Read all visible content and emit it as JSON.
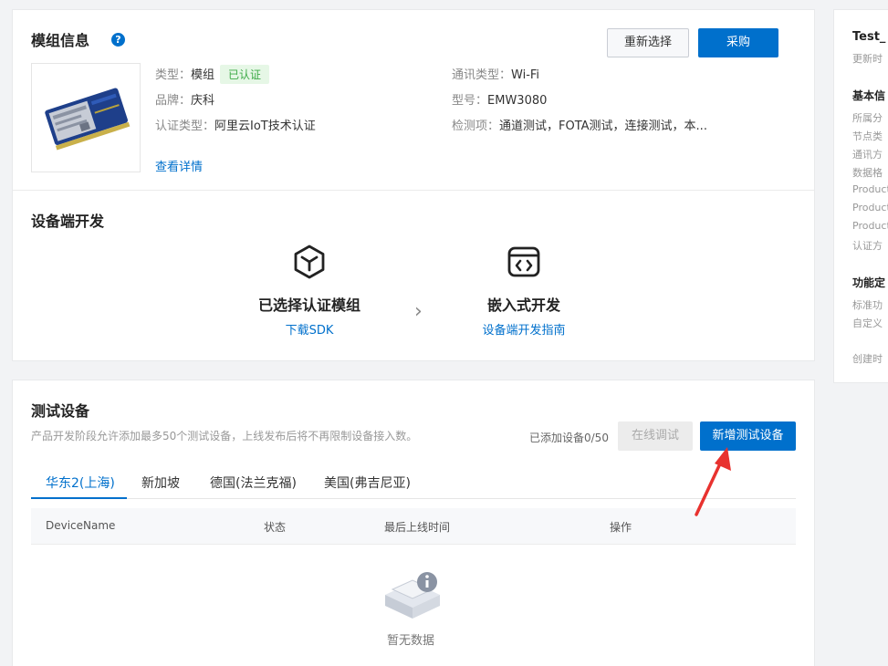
{
  "module": {
    "title": "模组信息",
    "help": "?",
    "reselect_label": "重新选择",
    "purchase_label": "采购",
    "type_key": "类型：",
    "type_val": "模组",
    "certified_tag": "已认证",
    "brand_key": "品牌：",
    "brand_val": "庆科",
    "cert_key": "认证类型：",
    "cert_val": "阿里云IoT技术认证",
    "comm_key": "通讯类型：",
    "comm_val": "Wi-Fi",
    "model_key": "型号：",
    "model_val": "EMW3080",
    "test_key": "检测项：",
    "test_val": "通道测试，FOTA测试，连接测试，本...",
    "detail_link": "查看详情"
  },
  "device_dev": {
    "title": "设备端开发",
    "step1_title": "已选择认证模组",
    "step1_link": "下载SDK",
    "step2_title": "嵌入式开发",
    "step2_link": "设备端开发指南"
  },
  "test_devices": {
    "title": "测试设备",
    "desc": "产品开发阶段允许添加最多50个测试设备，上线发布后将不再限制设备接入数。",
    "count": "已添加设备0/50",
    "online_debug": "在线调试",
    "add_device": "新增测试设备",
    "tabs": [
      "华东2(上海)",
      "新加坡",
      "德国(法兰克福)",
      "美国(弗吉尼亚)"
    ],
    "columns": [
      "DeviceName",
      "状态",
      "最后上线时间",
      "操作"
    ],
    "empty": "暂无数据"
  },
  "right_panel": {
    "title": "Test_",
    "updated": "更新时",
    "basic": "基本信",
    "rows": [
      "所属分",
      "节点类",
      "通讯方",
      "数据格",
      "Product",
      "Product",
      "Product",
      "认证方"
    ],
    "func": "功能定",
    "func_rows": [
      "标准功",
      "自定义"
    ],
    "created": "创建时"
  },
  "colors": {
    "primary": "#0070cc",
    "annotation": "#e8322f"
  }
}
